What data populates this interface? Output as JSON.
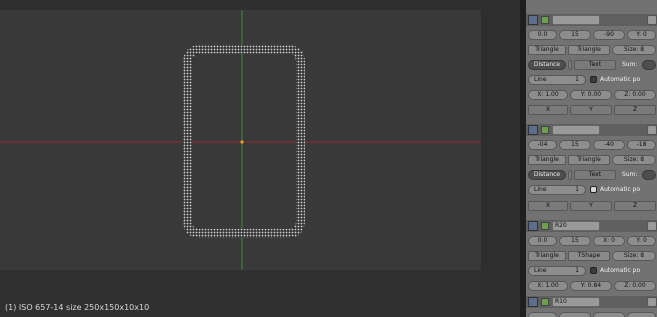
{
  "viewport": {
    "status_text": "(1) ISO 657-14 size 250x150x10x10"
  },
  "panel": {
    "block1": {
      "header_name": "",
      "loc": [
        "0.0",
        "15",
        "-90",
        "Y: 0"
      ],
      "type_a": "Triangle",
      "type_b": "Triangle",
      "size": "Size: 8",
      "mode": "Distance",
      "text_btn": "Text",
      "sum": "Sum:",
      "line": "Line",
      "line_val": "1",
      "auto_label": "Automatic po",
      "coords": [
        "X: 1.00",
        "Y: 0.00",
        "Z: 0.00"
      ],
      "axes": [
        "X",
        "Y",
        "Z"
      ]
    },
    "block2": {
      "header_name": "",
      "loc": [
        "-04",
        "15",
        "-40",
        "-18"
      ],
      "type_a": "Triangle",
      "type_b": "Triangle",
      "size": "Size: 8",
      "mode": "Distance",
      "text_btn": "Text",
      "sum": "Sum:",
      "line": "Line",
      "line_val": "1",
      "auto_label": "Automatic po",
      "axes": [
        "X",
        "Y",
        "Z"
      ]
    },
    "block3": {
      "header_name": "R20",
      "loc": [
        "0.0",
        "15",
        "X: 0",
        "Y: 0"
      ],
      "type_a": "Triangle",
      "type_b": "TShape",
      "size": "Size: 8",
      "line": "Line",
      "line_val": "1",
      "auto_label": "Automatic po",
      "coords": [
        "X: 1.00",
        "Y: 0.84",
        "Z: 0.00"
      ]
    },
    "block4": {
      "header_name": "R10"
    }
  }
}
